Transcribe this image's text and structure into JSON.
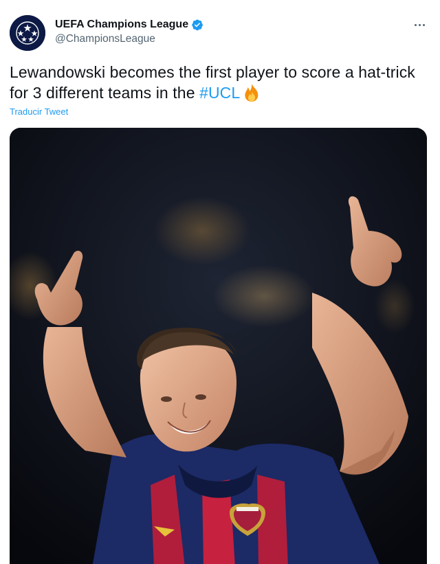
{
  "account": {
    "display_name": "UEFA Champions League",
    "handle": "@ChampionsLeague",
    "verified": true,
    "avatar_icon": "ucl-starball-logo"
  },
  "tweet": {
    "text_main": "Lewandowski becomes the first player to score a hat-trick for 3 different teams in the ",
    "hashtag": "#UCL",
    "emoji_icon": "fire-icon",
    "translate_label": "Traducir Tweet"
  },
  "media": {
    "alt": "Footballer in a blue and red striped Barcelona shirt pointing both index fingers up in celebration"
  },
  "colors": {
    "accent": "#1d9bf0",
    "secondary_text": "#536471",
    "avatar_bg": "#0d1a45"
  }
}
